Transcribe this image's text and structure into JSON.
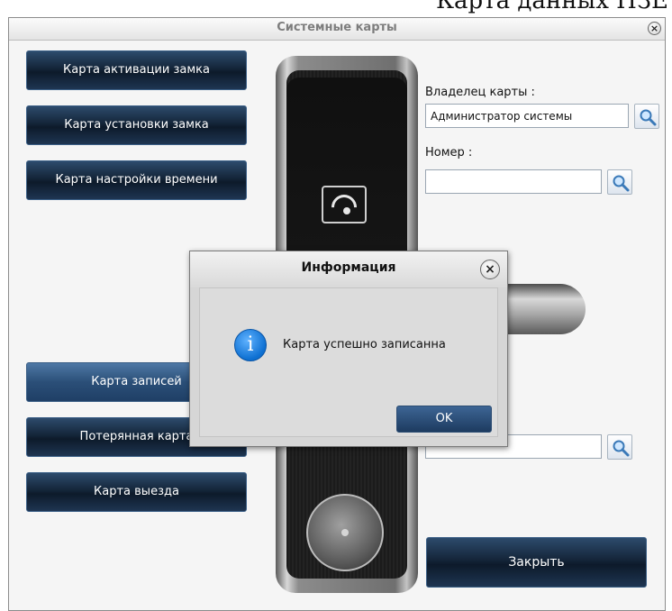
{
  "page_heading": "Карта данных ПЗЕ",
  "window": {
    "title": "Системные карты",
    "close_glyph": "×"
  },
  "left_buttons": [
    {
      "label": "Карта активации замка"
    },
    {
      "label": "Карта установки замка"
    },
    {
      "label": "Карта настройки времени"
    },
    {
      "label": "Карта записей"
    },
    {
      "label": "Потерянная карта"
    },
    {
      "label": "Карта выезда"
    }
  ],
  "form": {
    "owner_label": "Владелец карты :",
    "owner_value": "Администратор системы",
    "number_label": "Номер :",
    "number_value": "",
    "extra_value": ""
  },
  "close_button_label": "Закрыть",
  "dialog": {
    "title": "Информация",
    "close_glyph": "×",
    "icon_glyph": "i",
    "message": "Карта успешно записанна",
    "ok_label": "OK"
  },
  "colors": {
    "button_dark": "#142539",
    "button_active": "#2b4f78",
    "info_icon": "#0d6fd1"
  },
  "icons": [
    "close-icon",
    "search-icon",
    "info-icon"
  ]
}
